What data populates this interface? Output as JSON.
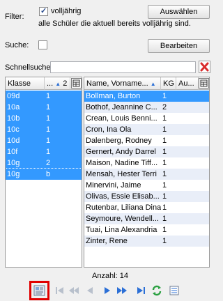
{
  "filter": {
    "label": "Filter:",
    "checkbox_label": "volljährig",
    "checked": true,
    "description": "alle Schüler die aktuell bereits volljährig sind.",
    "select_button": "Auswählen"
  },
  "search": {
    "label": "Suche:",
    "checked": false,
    "edit_button": "Bearbeiten"
  },
  "quicksearch": {
    "label": "Schnellsuche",
    "value": ""
  },
  "class_table": {
    "headers": [
      "Klasse",
      "...",
      "2"
    ],
    "rows": [
      {
        "klasse": "09d",
        "val": "1",
        "selected": true
      },
      {
        "klasse": "10a",
        "val": "1",
        "selected": true
      },
      {
        "klasse": "10b",
        "val": "1",
        "selected": true
      },
      {
        "klasse": "10c",
        "val": "1",
        "selected": true
      },
      {
        "klasse": "10d",
        "val": "1",
        "selected": true
      },
      {
        "klasse": "10f",
        "val": "1",
        "selected": true
      },
      {
        "klasse": "10g",
        "val": "2",
        "selected": true
      },
      {
        "klasse": "10g",
        "val": "b",
        "selected": true
      }
    ]
  },
  "student_table": {
    "headers": [
      "Name, Vorname...",
      "KG",
      "Au..."
    ],
    "rows": [
      {
        "name": "Bollman, Burton",
        "kg": "1",
        "selected": true
      },
      {
        "name": "Bothof, Jeannine C...",
        "kg": "2",
        "selected": false
      },
      {
        "name": "Crean, Louis Benni...",
        "kg": "1",
        "selected": false
      },
      {
        "name": "Cron, Ina Ola",
        "kg": "1",
        "selected": false
      },
      {
        "name": "Dalenberg, Rodney",
        "kg": "1",
        "selected": false
      },
      {
        "name": "Gernert, Andy Darrel",
        "kg": "1",
        "selected": false
      },
      {
        "name": "Maison, Nadine Tiff...",
        "kg": "1",
        "selected": false
      },
      {
        "name": "Mensah, Hester Terri",
        "kg": "1",
        "selected": false
      },
      {
        "name": "Minervini, Jaime",
        "kg": "1",
        "selected": false
      },
      {
        "name": "Olivas, Essie Elisab...",
        "kg": "1",
        "selected": false
      },
      {
        "name": "Rutenbar, Liliana Dina b",
        "kg": "1",
        "selected": false
      },
      {
        "name": "Seymoure, Wendell...",
        "kg": "1",
        "selected": false
      },
      {
        "name": "Tuai, Lina Alexandria",
        "kg": "1",
        "selected": false
      },
      {
        "name": "Zinter, Rene",
        "kg": "1",
        "selected": false
      }
    ]
  },
  "footer": {
    "count_label": "Anzahl: 14"
  },
  "colors": {
    "selection": "#3399ff",
    "zebra": "#e9eef8",
    "highlight_border": "#e00000",
    "nav_blue": "#2b6fd6",
    "refresh_green": "#2aa040",
    "clear_red": "#d92b2b"
  },
  "icons": {
    "table_options": "table-options-icon",
    "clear": "clear-icon",
    "details": "details-icon",
    "first": "first-icon",
    "prev_fast": "previous-fast-icon",
    "prev": "previous-icon",
    "next": "next-icon",
    "next_fast": "next-fast-icon",
    "last": "last-icon",
    "refresh": "refresh-icon",
    "list": "list-icon"
  }
}
